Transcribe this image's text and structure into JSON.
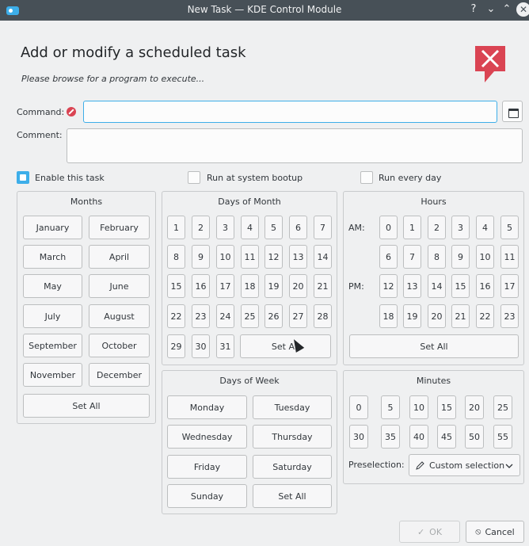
{
  "window": {
    "title": "New Task — KDE Control Module",
    "help_label": "?",
    "minimize_label": "⌄",
    "maximize_label": "⌃",
    "close_label": "✕"
  },
  "header": {
    "title": "Add or modify a scheduled task",
    "subtitle": "Please browse for a program to execute..."
  },
  "form": {
    "command_label": "Command:",
    "command_value": "",
    "comment_label": "Comment:",
    "comment_value": "",
    "enable_label": "Enable this task",
    "enable_checked": true,
    "bootup_label": "Run at system bootup",
    "bootup_checked": false,
    "everyday_label": "Run every day",
    "everyday_checked": false
  },
  "months": {
    "title": "Months",
    "items": [
      "January",
      "February",
      "March",
      "April",
      "May",
      "June",
      "July",
      "August",
      "September",
      "October",
      "November",
      "December"
    ],
    "set_all": "Set All"
  },
  "days_of_month": {
    "title": "Days of Month",
    "items": [
      "1",
      "2",
      "3",
      "4",
      "5",
      "6",
      "7",
      "8",
      "9",
      "10",
      "11",
      "12",
      "13",
      "14",
      "15",
      "16",
      "17",
      "18",
      "19",
      "20",
      "21",
      "22",
      "23",
      "24",
      "25",
      "26",
      "27",
      "28",
      "29",
      "30",
      "31"
    ],
    "set_all": "Set All"
  },
  "days_of_week": {
    "title": "Days of Week",
    "items": [
      "Monday",
      "Tuesday",
      "Wednesday",
      "Thursday",
      "Friday",
      "Saturday",
      "Sunday"
    ],
    "set_all": "Set All"
  },
  "hours": {
    "title": "Hours",
    "am_label": "AM:",
    "pm_label": "PM:",
    "am": [
      "0",
      "1",
      "2",
      "3",
      "4",
      "5",
      "6",
      "7",
      "8",
      "9",
      "10",
      "11"
    ],
    "pm": [
      "12",
      "13",
      "14",
      "15",
      "16",
      "17",
      "18",
      "19",
      "20",
      "21",
      "22",
      "23"
    ],
    "set_all": "Set All"
  },
  "minutes": {
    "title": "Minutes",
    "items": [
      "0",
      "5",
      "10",
      "15",
      "20",
      "25",
      "30",
      "35",
      "40",
      "45",
      "50",
      "55"
    ],
    "preselection_label": "Preselection:",
    "preselection_value": "Custom selection",
    "preselection_icon": "pen-icon"
  },
  "footer": {
    "ok_label": "OK",
    "cancel_label": "Cancel",
    "ok_icon": "✓",
    "cancel_icon": "⦸"
  },
  "colors": {
    "accent": "#3daee9",
    "titlebar": "#475057",
    "kde_red": "#da4453"
  }
}
